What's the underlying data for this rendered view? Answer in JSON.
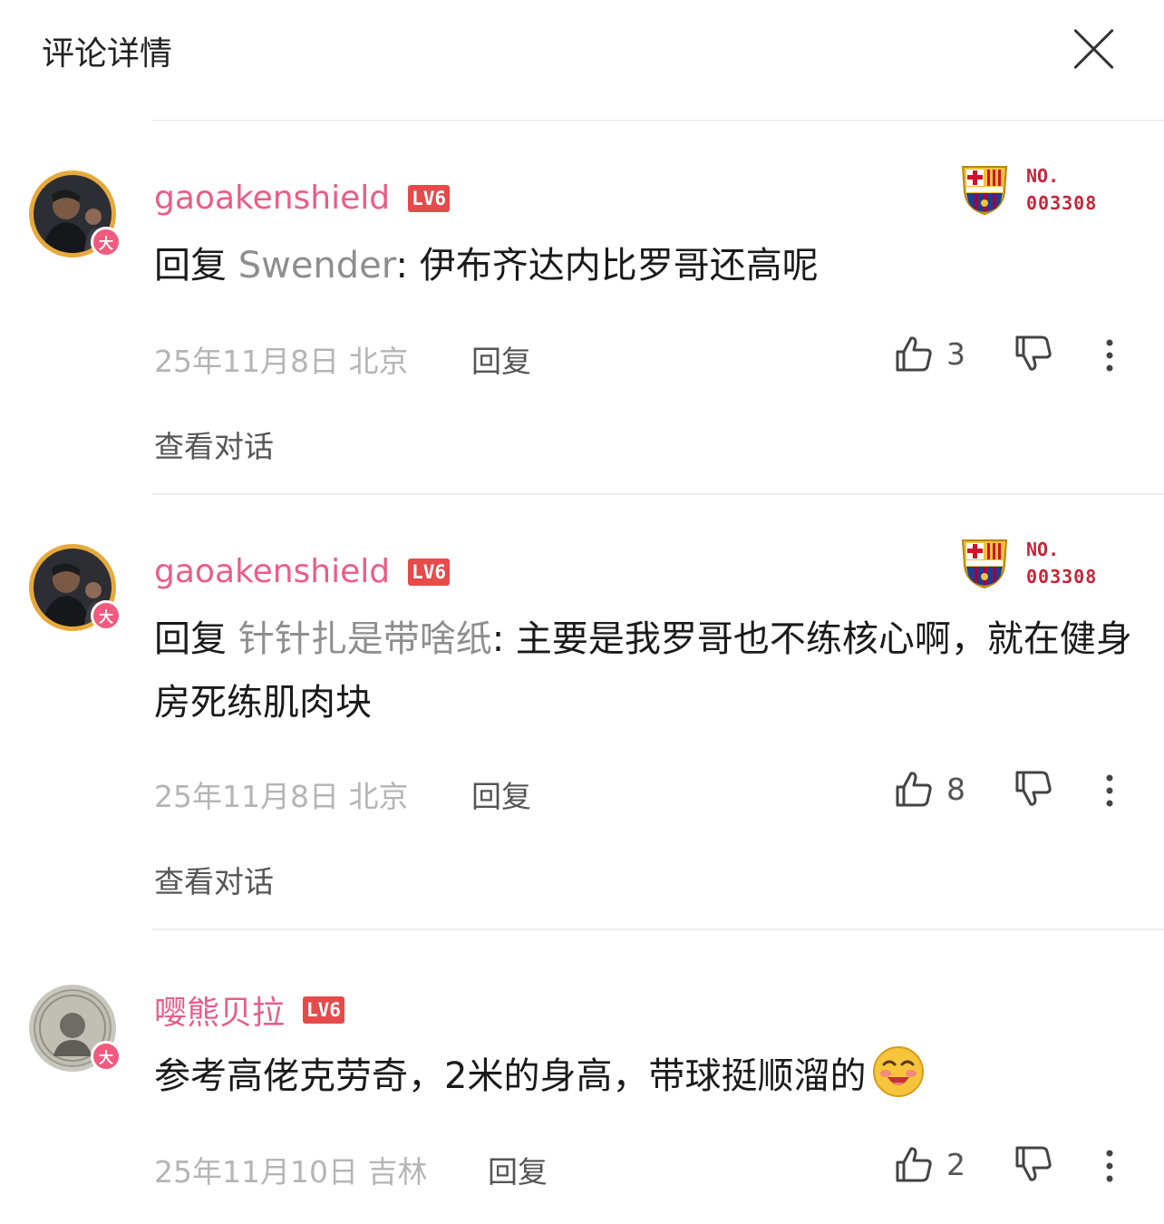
{
  "header": {
    "title": "评论详情",
    "close_icon": "close-icon"
  },
  "comments": [
    {
      "username": "gaoakenshield",
      "level": "LV6",
      "avatar_badge": "大",
      "fan_card": {
        "label": "NO.",
        "number": "003308"
      },
      "reply_prefix": "回复",
      "reply_to": "Swender",
      "text": ": 伊布齐达内比罗哥还高呢",
      "date_location": "25年11月8日 北京",
      "reply_label": "回复",
      "likes": "3",
      "view_conversation": "查看对话"
    },
    {
      "username": "gaoakenshield",
      "level": "LV6",
      "avatar_badge": "大",
      "fan_card": {
        "label": "NO.",
        "number": "003308"
      },
      "reply_prefix": "回复",
      "reply_to": "针针扎是带啥纸",
      "text": ": 主要是我罗哥也不练核心啊，就在健身房死练肌肉块",
      "date_location": "25年11月8日 北京",
      "reply_label": "回复",
      "likes": "8",
      "view_conversation": "查看对话"
    },
    {
      "username": "嘤熊贝拉",
      "level": "LV6",
      "avatar_badge": "大",
      "text": "参考高佬克劳奇，2米的身高，带球挺顺溜的",
      "emoji": "laughing-drooling-emoji",
      "date_location": "25年11月10日 吉林",
      "reply_label": "回复",
      "likes": "2"
    }
  ],
  "colors": {
    "username": "#ea5d87",
    "level_badge": "#e54b4b",
    "fan_number": "#c4263a",
    "meta_gray": "#b5b5b5",
    "reply_to_gray": "#8e8e8e"
  }
}
